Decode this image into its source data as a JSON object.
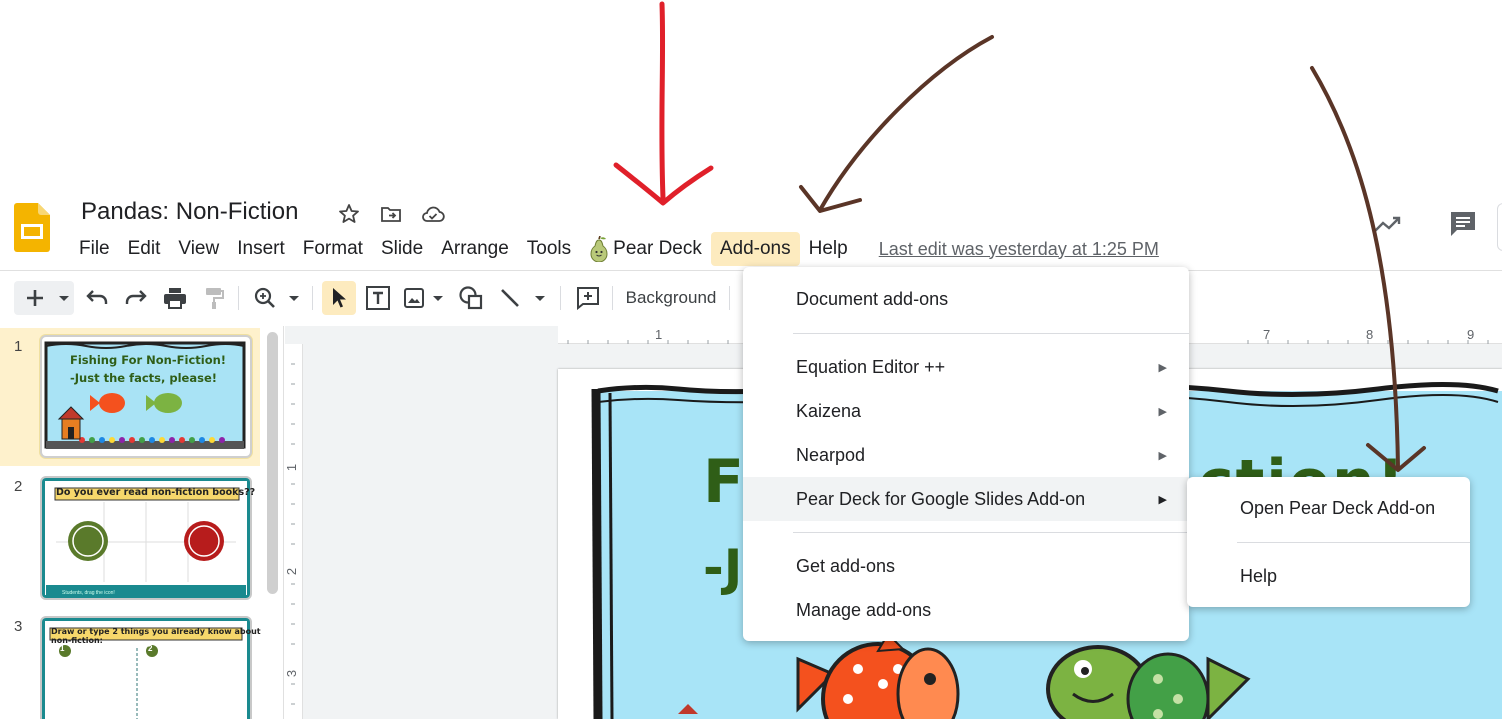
{
  "document": {
    "title": "Pandas:  Non-Fiction"
  },
  "menubar": {
    "items": [
      "File",
      "Edit",
      "View",
      "Insert",
      "Format",
      "Slide",
      "Arrange",
      "Tools"
    ],
    "pear_deck": "Pear Deck",
    "addons": "Add-ons",
    "help": "Help",
    "last_edit": "Last edit was yesterday at 1:25 PM"
  },
  "toolbar": {
    "background_label": "Background"
  },
  "filmstrip": {
    "slides": [
      {
        "number": "1",
        "title_line1": "Fishing For Non-Fiction!",
        "title_line2": "-Just the facts, please!"
      },
      {
        "number": "2",
        "title": "Do you ever read non-fiction books??",
        "footer": "Students, drag the icon!"
      },
      {
        "number": "3",
        "title": "Draw or type 2 things you already know about non-fiction:",
        "badge1": "1",
        "badge2": "2"
      }
    ]
  },
  "ruler": {
    "top": [
      "1",
      "7",
      "8",
      "9"
    ],
    "left": [
      "1",
      "2",
      "3"
    ]
  },
  "slide": {
    "title_line1_visible": "Fi",
    "title_line1_end": "ction!",
    "title_line2_visible": "-J"
  },
  "addons_menu": {
    "document_addons": "Document add-ons",
    "items": [
      {
        "label": "Equation Editor ++"
      },
      {
        "label": "Kaizena"
      },
      {
        "label": "Nearpod"
      },
      {
        "label": "Pear Deck for Google Slides Add-on"
      }
    ],
    "get_addons": "Get add-ons",
    "manage_addons": "Manage add-ons"
  },
  "submenu": {
    "open": "Open Pear Deck Add-on",
    "help": "Help"
  },
  "colors": {
    "accent": "#fdebbf",
    "selected_slide": "#fef1cc",
    "slides_yellow": "#f4b400",
    "annotation_red": "#e0202a",
    "annotation_brown": "#5a3527"
  }
}
